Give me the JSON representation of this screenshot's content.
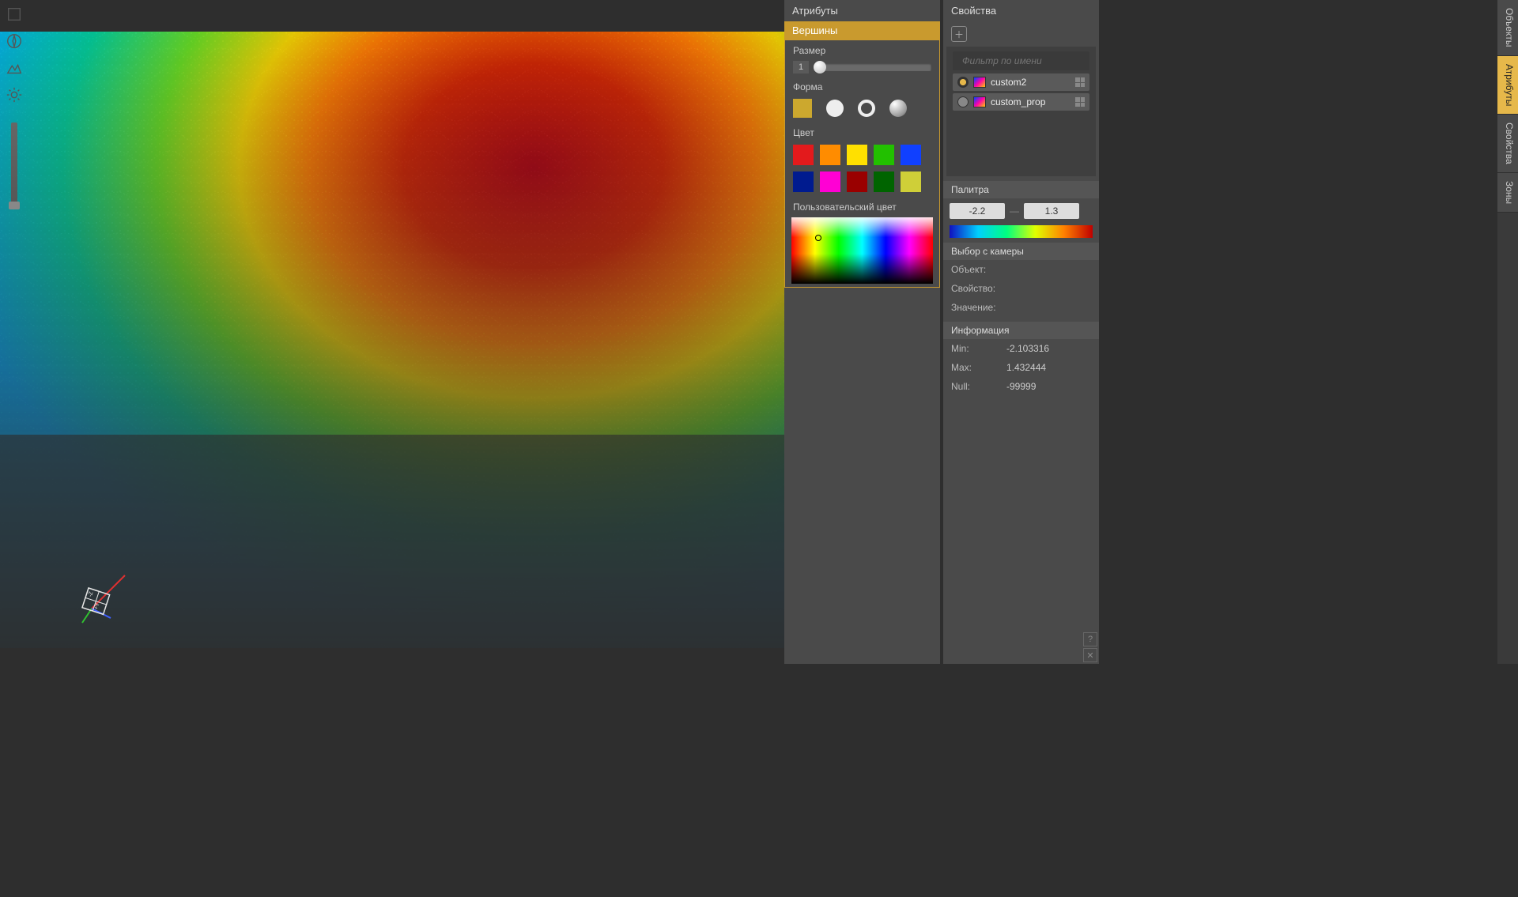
{
  "panels": {
    "attributes": {
      "title": "Атрибуты",
      "vertices_header": "Вершины",
      "size_label": "Размер",
      "size_value": "1",
      "shape_label": "Форма",
      "color_label": "Цвет",
      "swatches": [
        "#e31a1c",
        "#ff8c00",
        "#ffe000",
        "#22c000",
        "#1040ff",
        "#001b8f",
        "#ff00d4",
        "#9a0000",
        "#006400",
        "#cfcf38"
      ],
      "custom_color_label": "Пользовательский цвет"
    },
    "properties": {
      "title": "Свойства",
      "filter_placeholder": "Фильтр по имени",
      "layers": [
        {
          "name": "custom2",
          "selected": true
        },
        {
          "name": "custom_prop",
          "selected": false
        }
      ],
      "palette_header": "Палитра",
      "palette_min": "-2.2",
      "palette_max": "1.3",
      "camera_pick_header": "Выбор с камеры",
      "object_label": "Объект:",
      "property_label": "Свойство:",
      "value_label": "Значение:",
      "info_header": "Информация",
      "info": {
        "min_label": "Min:",
        "min_value": "-2.103316",
        "max_label": "Max:",
        "max_value": "1.432444",
        "null_label": "Null:",
        "null_value": "-99999"
      }
    }
  },
  "right_tabs": [
    "Объекты",
    "Атрибуты",
    "Свойства",
    "Зоны"
  ],
  "right_tabs_active": 1,
  "gizmo": {
    "z": "-Z",
    "y": "+Y"
  }
}
